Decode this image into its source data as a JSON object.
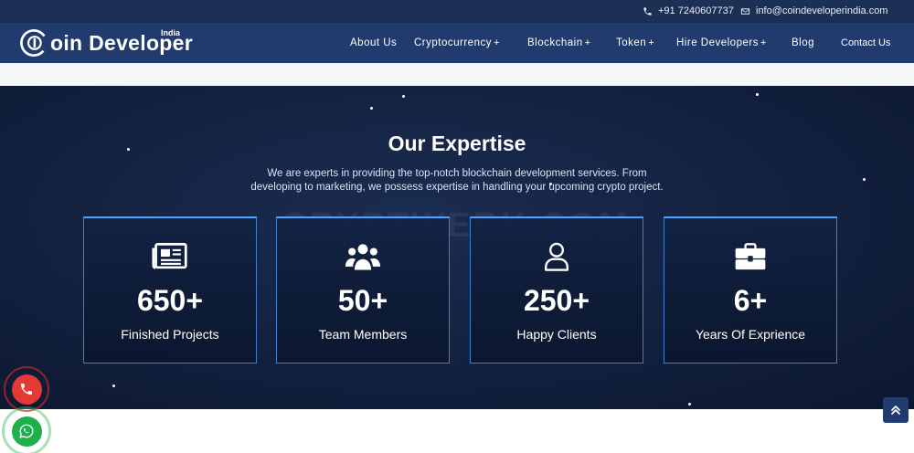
{
  "topbar": {
    "phone": "+91 7240607737",
    "email": "info@coindeveloperindia.com"
  },
  "brand": {
    "name": "oin Developer",
    "region": "India"
  },
  "nav": {
    "items": [
      {
        "label": "About Us",
        "has_dropdown": false
      },
      {
        "label": "Cryptocurrency",
        "has_dropdown": true
      },
      {
        "label": "Blockchain",
        "has_dropdown": true
      },
      {
        "label": "Token",
        "has_dropdown": true
      },
      {
        "label": "Hire Developers",
        "has_dropdown": true
      },
      {
        "label": "Blog",
        "has_dropdown": false
      }
    ],
    "contact": "Contact Us",
    "dropdown_symbol": "+"
  },
  "expertise": {
    "title": "Our Expertise",
    "description_line1": "We are experts in providing the top-notch blockchain development services. From",
    "description_line2": "developing to marketing, we possess expertise in handling your upcoming crypto project.",
    "watermark": "CRYPTWERK.COM",
    "stats": [
      {
        "value": "650+",
        "label": "Finished Projects",
        "icon": "newspaper-icon"
      },
      {
        "value": "50+",
        "label": "Team Members",
        "icon": "team-icon"
      },
      {
        "value": "250+",
        "label": "Happy Clients",
        "icon": "user-icon"
      },
      {
        "value": "6+",
        "label": "Years Of Exprience",
        "icon": "briefcase-icon"
      }
    ]
  },
  "colors": {
    "nav_bg": "#213b6e",
    "topbar_bg": "#1c2f55",
    "hero_bg": "#142341",
    "card_border": "#3f7fd0",
    "phone_button": "#e53935",
    "whatsapp_button": "#1faf4b"
  },
  "icons": {
    "phone": "phone-icon",
    "email": "email-icon",
    "logo": "coin-logo-icon",
    "call_float": "phone-icon",
    "whatsapp_float": "whatsapp-icon",
    "scroll_top": "double-chevron-up-icon"
  }
}
